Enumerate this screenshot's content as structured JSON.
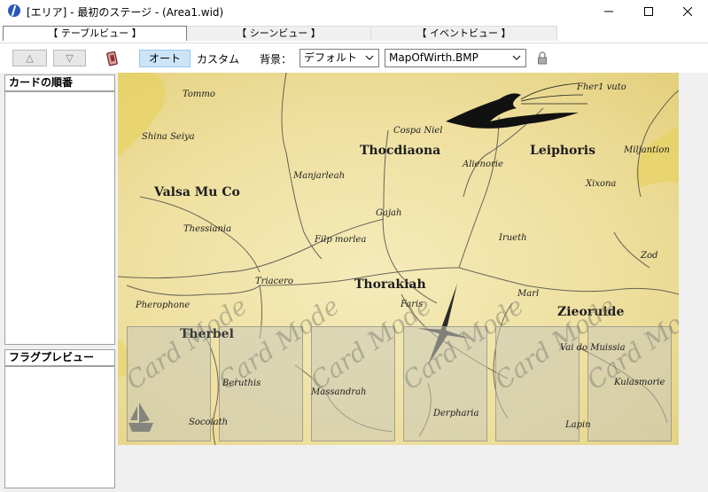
{
  "window": {
    "title": "[エリア] - 最初のステージ - (Area1.wid)",
    "minimize_icon": "minimize-icon",
    "maximize_icon": "maximize-icon",
    "close_icon": "close-icon"
  },
  "tabs": [
    {
      "label": "【 テーブルビュー 】",
      "active": true
    },
    {
      "label": "【 シーンビュー 】",
      "active": false
    },
    {
      "label": "【 イベントビュー 】",
      "active": false
    }
  ],
  "toolbar": {
    "up_label": "△",
    "down_label": "▽",
    "card_icon": "card-icon",
    "mode_auto": "オート",
    "mode_custom": "カスタム",
    "background_label": "背景：",
    "background_mode": "デフォルト",
    "background_file": "MapOfWirth.BMP",
    "lock_icon": "lock-icon"
  },
  "left_panel": {
    "card_order_title": "カードの順番",
    "flag_preview_title": "フラグプレビュー"
  },
  "map": {
    "places": [
      "Tommo",
      "Shina Seiya",
      "Cospa Niel",
      "Fher1 vuto",
      "Thocdiaona",
      "Leiphoris",
      "Alienorie",
      "Miljantion",
      "Valsa Mu Co",
      "Manjarleah",
      "Xixona",
      "Gajah",
      "Thessiania",
      "Filp morlea",
      "Irueth",
      "Zod",
      "Triacero",
      "Thorakiah",
      "Faris",
      "Marl",
      "Pherophone",
      "Zieoruide",
      "Therbel",
      "Beruthis",
      "Massandrah",
      "Vai do Muissia",
      "Kulasmorie",
      "Derpharia",
      "Socoiath",
      "Lapin"
    ],
    "card_watermark": "Card Mode"
  },
  "colors": {
    "accent": "#cce4f7",
    "map_paper": "#efe0a0",
    "panel_bg": "#f0f0f0"
  }
}
